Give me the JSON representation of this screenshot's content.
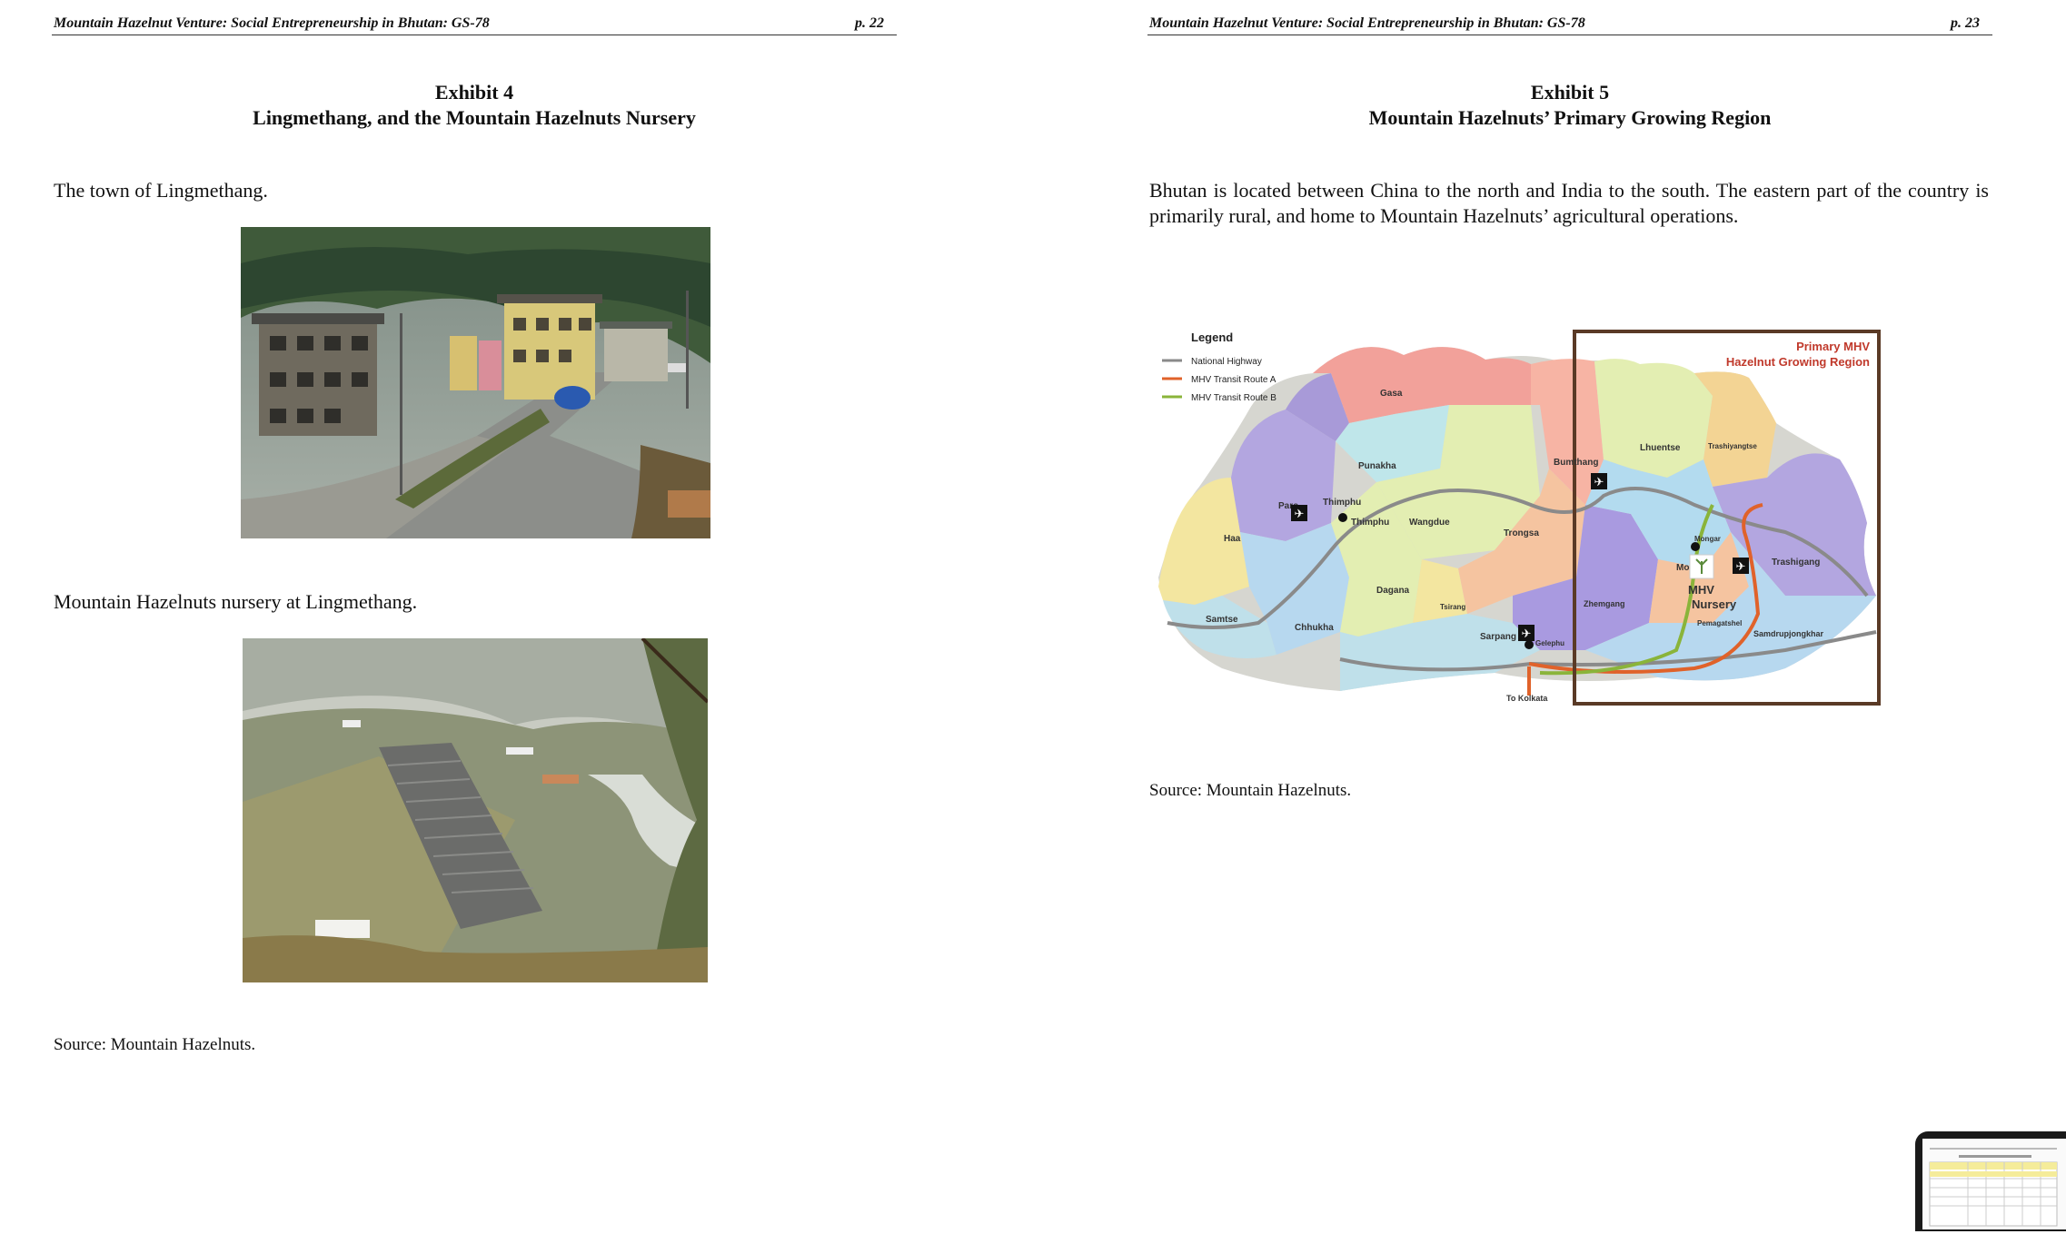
{
  "left_page": {
    "header_title": "Mountain Hazelnut Venture: Social Entrepreneurship in Bhutan: GS-78",
    "page_number": "p. 22",
    "exhibit_number": "Exhibit 4",
    "exhibit_title": "Lingmethang, and the Mountain Hazelnuts Nursery",
    "caption_1": "The town of Lingmethang.",
    "caption_2": "Mountain Hazelnuts nursery at Lingmethang.",
    "source": "Source: Mountain Hazelnuts."
  },
  "right_page": {
    "header_title": "Mountain Hazelnut Venture: Social Entrepreneurship in Bhutan: GS-78",
    "page_number": "p. 23",
    "exhibit_number": "Exhibit 5",
    "exhibit_title": "Mountain Hazelnuts’ Primary Growing Region",
    "paragraph": "Bhutan is located between China to the north and India to the south.  The eastern part of the country is primarily rural, and home to Mountain Hazelnuts’ agricultural operations.",
    "source": "Source: Mountain Hazelnuts.",
    "map": {
      "legend_title": "Legend",
      "legend_items": [
        {
          "label": "National Highway",
          "color": "#8a8a8a"
        },
        {
          "label": "MHV Transit Route A",
          "color": "#e0622a"
        },
        {
          "label": "MHV Transit Route B",
          "color": "#8ab43a"
        }
      ],
      "region_label_1": "Primary MHV",
      "region_label_2": "Hazelnut Growing Region",
      "districts": {
        "gasa": "Gasa",
        "punakha": "Punakha",
        "paro": "Paro",
        "thimphu_d": "Thimphu",
        "thimphu": "Thimphu",
        "wangdue": "Wangdue",
        "haa": "Haa",
        "samtse": "Samtse",
        "chhukha": "Chhukha",
        "dagana": "Dagana",
        "tsirang": "Tsirang",
        "sarpang": "Sarpang",
        "gelephu": "Gelephu",
        "trongsa": "Trongsa",
        "bumthang": "Bumthang",
        "lhuentse": "Lhuentse",
        "trashiyangtse": "Trashiyangtse",
        "mongar_town": "Mongar",
        "mongar": "Mongar",
        "trashigang": "Trashigang",
        "zhemgang": "Zhemgang",
        "pemagatshel": "Pemagatshel",
        "samdrupjongkhar": "Samdrupjongkhar",
        "to_kolkata": "To Kolkata",
        "mhv": "MHV",
        "nursery": "Nursery"
      }
    }
  }
}
